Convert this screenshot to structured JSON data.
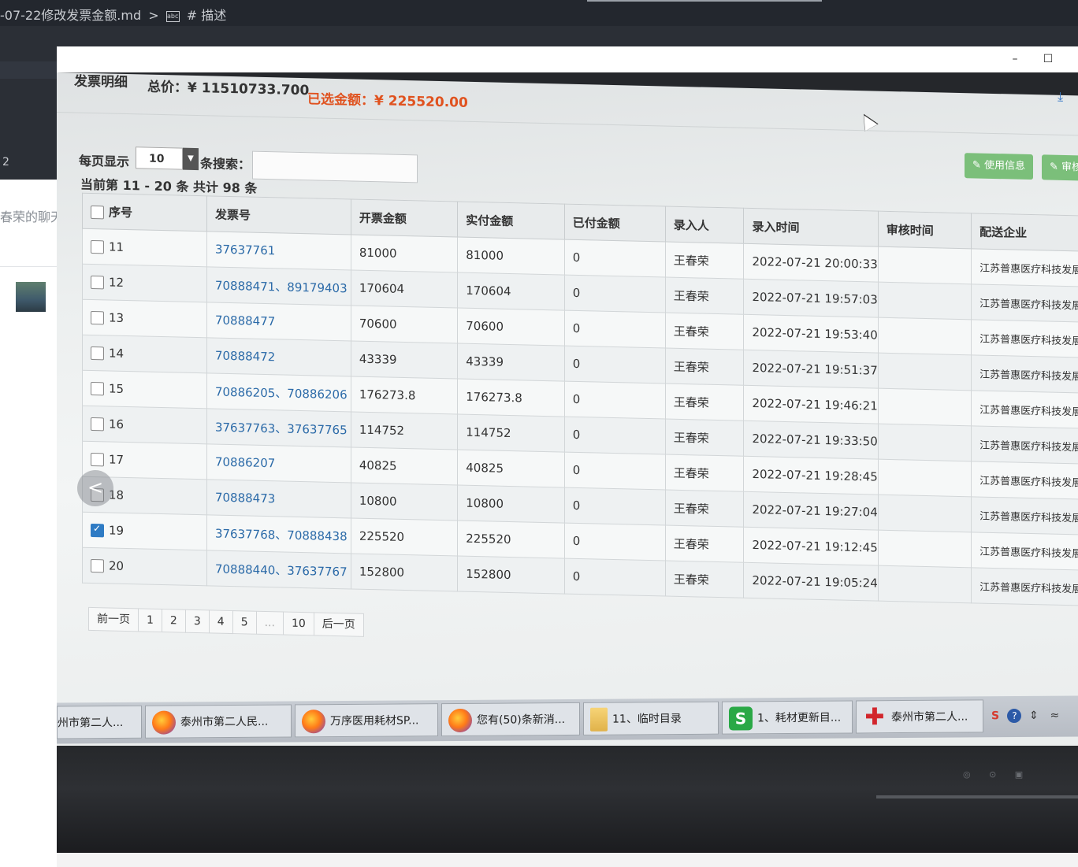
{
  "editor": {
    "breadcrumb_file": "-07-22修改发票金额.md",
    "breadcrumb_sep": ">",
    "breadcrumb_icon_text": "abc",
    "breadcrumb_heading": "# 描述",
    "line_number": "2",
    "chat_title": "春荣的聊天"
  },
  "viewer": {
    "minimize": "–",
    "maximize": "☐"
  },
  "screen": {
    "header_label": "发票明细",
    "total_price": "总价：¥ 11510733.700",
    "selected_amount": "已选金额：¥ 225520.00",
    "buttons": {
      "usage_info": "使用信息",
      "review": "审核"
    },
    "page_size_label": "每页显示",
    "page_size_value": "10",
    "search_label": "条搜索：",
    "summary": "当前第 11 - 20 条   共计 98 条",
    "columns": [
      "序号",
      "发票号",
      "开票金额",
      "实付金额",
      "已付金额",
      "录入人",
      "录入时间",
      "审核时间",
      "配送企业"
    ],
    "rows": [
      {
        "idx": "11",
        "invoice": "37637761",
        "billed": "81000",
        "paid_actual": "81000",
        "paid": "0",
        "entered_by": "王春荣",
        "entered_at": "2022-07-21 20:00:33",
        "reviewed_at": "",
        "company": "江苏普惠医疗科技发展",
        "checked": false
      },
      {
        "idx": "12",
        "invoice": "70888471、89179403",
        "billed": "170604",
        "paid_actual": "170604",
        "paid": "0",
        "entered_by": "王春荣",
        "entered_at": "2022-07-21 19:57:03",
        "reviewed_at": "",
        "company": "江苏普惠医疗科技发展",
        "checked": false
      },
      {
        "idx": "13",
        "invoice": "70888477",
        "billed": "70600",
        "paid_actual": "70600",
        "paid": "0",
        "entered_by": "王春荣",
        "entered_at": "2022-07-21 19:53:40",
        "reviewed_at": "",
        "company": "江苏普惠医疗科技发展",
        "checked": false
      },
      {
        "idx": "14",
        "invoice": "70888472",
        "billed": "43339",
        "paid_actual": "43339",
        "paid": "0",
        "entered_by": "王春荣",
        "entered_at": "2022-07-21 19:51:37",
        "reviewed_at": "",
        "company": "江苏普惠医疗科技发展",
        "checked": false
      },
      {
        "idx": "15",
        "invoice": "70886205、70886206",
        "billed": "176273.8",
        "paid_actual": "176273.8",
        "paid": "0",
        "entered_by": "王春荣",
        "entered_at": "2022-07-21 19:46:21",
        "reviewed_at": "",
        "company": "江苏普惠医疗科技发展有",
        "checked": false
      },
      {
        "idx": "16",
        "invoice": "37637763、37637765",
        "billed": "114752",
        "paid_actual": "114752",
        "paid": "0",
        "entered_by": "王春荣",
        "entered_at": "2022-07-21 19:33:50",
        "reviewed_at": "",
        "company": "江苏普惠医疗科技发展有",
        "checked": false
      },
      {
        "idx": "17",
        "invoice": "70886207",
        "billed": "40825",
        "paid_actual": "40825",
        "paid": "0",
        "entered_by": "王春荣",
        "entered_at": "2022-07-21 19:28:45",
        "reviewed_at": "",
        "company": "江苏普惠医疗科技发展有",
        "checked": false
      },
      {
        "idx": "18",
        "invoice": "70888473",
        "billed": "10800",
        "paid_actual": "10800",
        "paid": "0",
        "entered_by": "王春荣",
        "entered_at": "2022-07-21 19:27:04",
        "reviewed_at": "",
        "company": "江苏普惠医疗科技发展有",
        "checked": false
      },
      {
        "idx": "19",
        "invoice": "37637768、70888438",
        "billed": "225520",
        "paid_actual": "225520",
        "paid": "0",
        "entered_by": "王春荣",
        "entered_at": "2022-07-21 19:12:45",
        "reviewed_at": "",
        "company": "江苏普惠医疗科技发展有限",
        "checked": true
      },
      {
        "idx": "20",
        "invoice": "70888440、37637767",
        "billed": "152800",
        "paid_actual": "152800",
        "paid": "0",
        "entered_by": "王春荣",
        "entered_at": "2022-07-21 19:05:24",
        "reviewed_at": "",
        "company": "江苏普惠医疗科技发展有限",
        "checked": false
      }
    ],
    "pagination": [
      "前一页",
      "1",
      "2",
      "3",
      "4",
      "5",
      "...",
      "10",
      "后一页"
    ],
    "current_page": "2",
    "nav_prev": "<"
  },
  "taskbar": {
    "items": [
      {
        "label": "州市第二人...",
        "icon": "none"
      },
      {
        "label": "泰州市第二人民...",
        "icon": "firefox-icon"
      },
      {
        "label": "万序医用耗材SP...",
        "icon": "firefox-icon"
      },
      {
        "label": "您有(50)条新消...",
        "icon": "firefox-icon"
      },
      {
        "label": "11、临时目录",
        "icon": "folder-icon"
      },
      {
        "label": "1、耗材更新目...",
        "icon": "wps-icon"
      },
      {
        "label": "泰州市第二人...",
        "icon": "red-cross-icon"
      }
    ],
    "tray": [
      "S",
      "?",
      "⇕",
      "≈"
    ]
  }
}
